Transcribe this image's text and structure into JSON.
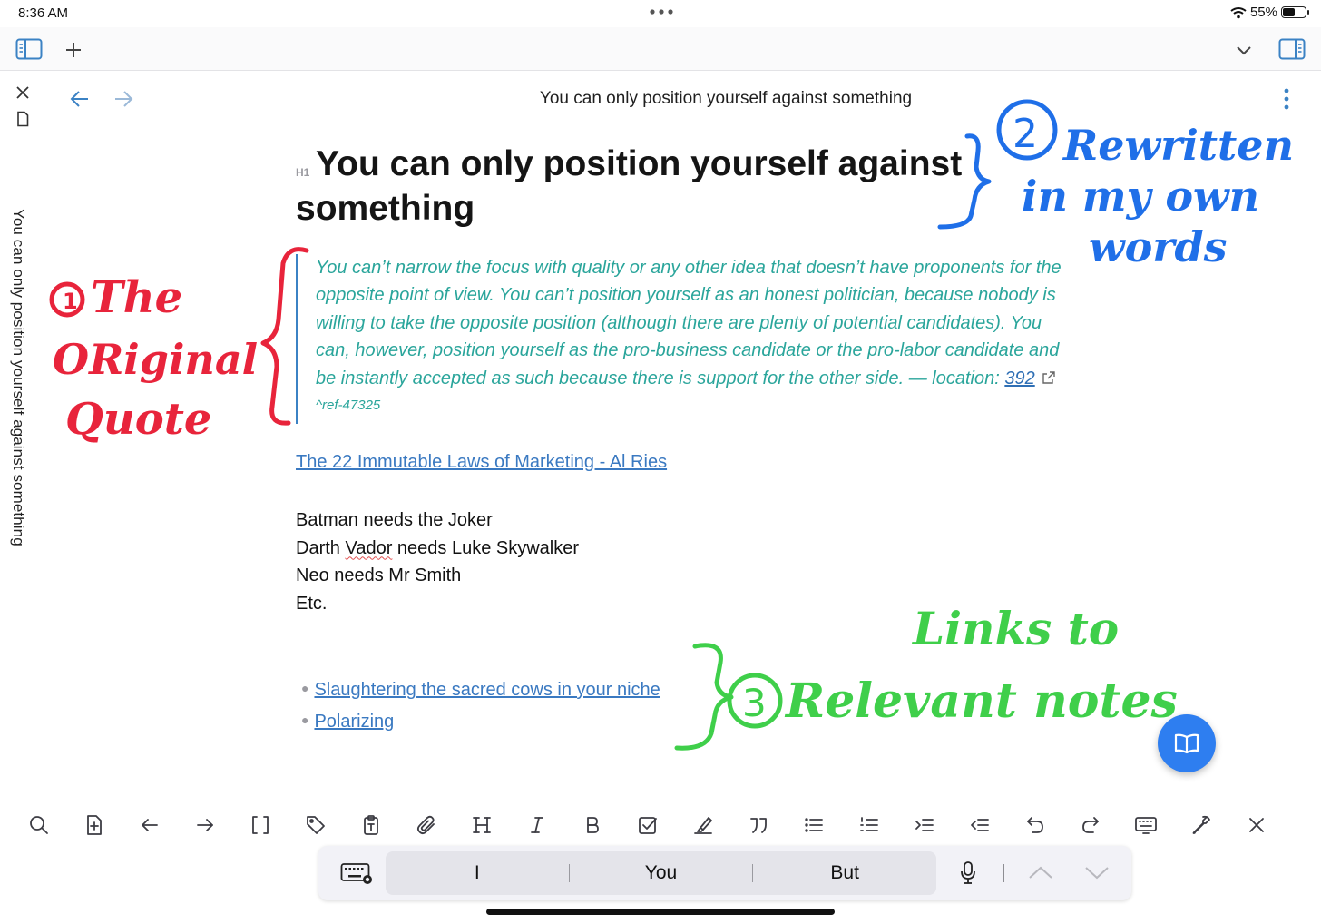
{
  "status_bar": {
    "time": "8:36 AM",
    "battery": "55%",
    "battery_level": 0.55
  },
  "side_tab": {
    "title": "You can only position yourself against something"
  },
  "nav": {
    "title": "You can only position yourself against something"
  },
  "note": {
    "heading_badge": "H1",
    "heading": "You can only position yourself against something",
    "quote": {
      "text": "You can’t narrow the focus with quality or any other idea that doesn’t have proponents for the opposite point of view. You can’t position yourself as an honest politician, because nobody is willing to take the opposite position (although there are plenty of potential candidates). You can, however, position yourself as the pro-business candidate or the pro-labor candidate and be instantly accepted as such because there is support for the other side. — location: ",
      "location_link": "392",
      "ref": "^ref-47325"
    },
    "source_link": "The 22 Immutable Laws of Marketing - Al Ries",
    "lines": [
      {
        "before": "Batman needs the Joker"
      },
      {
        "before": "Darth ",
        "squiggle": "Vador",
        "after": " needs Luke Skywalker"
      },
      {
        "before": "Neo needs Mr Smith"
      },
      {
        "before": "Etc."
      }
    ],
    "related_links": [
      "Slaughtering the sacred cows in your niche",
      "Polarizing"
    ]
  },
  "keyboard": {
    "suggestions": [
      "I",
      "You",
      "But"
    ]
  },
  "annotations": {
    "red": {
      "number": "1",
      "lines": [
        "The",
        "ORiginal",
        "Quote"
      ],
      "color": "#e8243b"
    },
    "blue": {
      "number": "2",
      "lines": [
        "Rewritten",
        "in my own",
        "words"
      ],
      "color": "#1f6fe8"
    },
    "green": {
      "number": "3",
      "lines": [
        "Links to",
        "Relevant notes"
      ],
      "color": "#3fcf4a"
    }
  },
  "colors": {
    "accent": "#2e7ef0",
    "quote": "#2aa59b",
    "link": "#3a79c1"
  }
}
